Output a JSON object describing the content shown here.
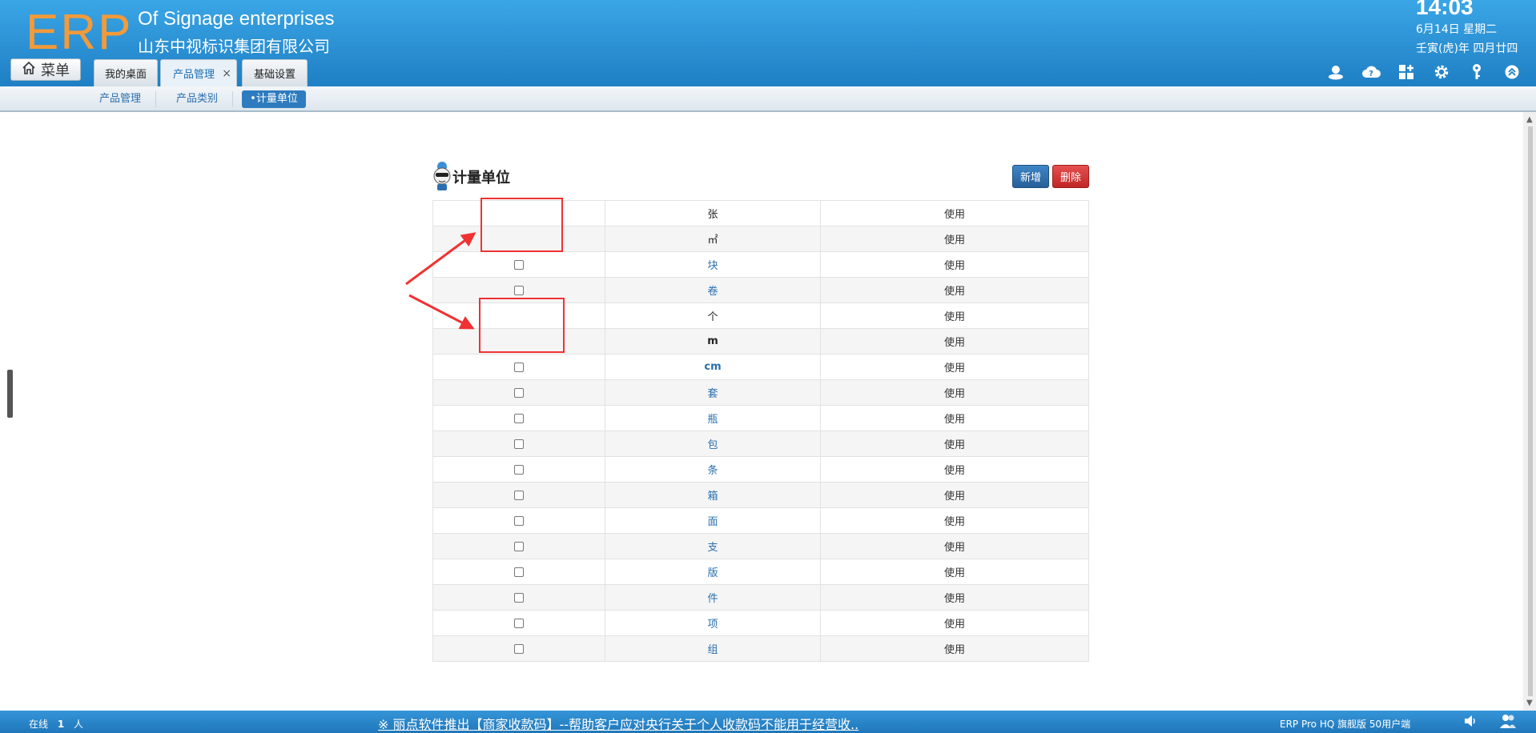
{
  "header": {
    "logo": "ERP",
    "company_en": "Of Signage enterprises",
    "company_cn": "山东中视标识集团有限公司",
    "time": "14:03",
    "date": "6月14日 星期二",
    "lunar": "壬寅(虎)年 四月廿四",
    "menu_label": "菜单",
    "tabs": [
      {
        "label": "我的桌面"
      },
      {
        "label": "产品管理",
        "close": "×"
      },
      {
        "label": "基础设置"
      }
    ],
    "tools": [
      "user-icon",
      "cloud-help-icon",
      "apps-icon",
      "gear-icon",
      "key-icon",
      "collapse-up-icon"
    ]
  },
  "subnav": {
    "items": [
      {
        "label": "产品管理"
      },
      {
        "label": "产品类别"
      },
      {
        "label": "•计量单位"
      }
    ]
  },
  "page": {
    "title": "计量单位",
    "add_label": "新增",
    "delete_label": "删除"
  },
  "units": [
    {
      "name": "张",
      "status": "使用",
      "checkbox": false,
      "link": false
    },
    {
      "name": "㎡",
      "status": "使用",
      "checkbox": false,
      "link": false
    },
    {
      "name": "块",
      "status": "使用",
      "checkbox": true,
      "link": true
    },
    {
      "name": "卷",
      "status": "使用",
      "checkbox": true,
      "link": true
    },
    {
      "name": "个",
      "status": "使用",
      "checkbox": false,
      "link": false
    },
    {
      "name": "m",
      "status": "使用",
      "checkbox": false,
      "link": false,
      "bold": true
    },
    {
      "name": "cm",
      "status": "使用",
      "checkbox": true,
      "link": true,
      "bold": true
    },
    {
      "name": "套",
      "status": "使用",
      "checkbox": true,
      "link": true
    },
    {
      "name": "瓶",
      "status": "使用",
      "checkbox": true,
      "link": true
    },
    {
      "name": "包",
      "status": "使用",
      "checkbox": true,
      "link": true
    },
    {
      "name": "条",
      "status": "使用",
      "checkbox": true,
      "link": true
    },
    {
      "name": "箱",
      "status": "使用",
      "checkbox": true,
      "link": true
    },
    {
      "name": "面",
      "status": "使用",
      "checkbox": true,
      "link": true
    },
    {
      "name": "支",
      "status": "使用",
      "checkbox": true,
      "link": true
    },
    {
      "name": "版",
      "status": "使用",
      "checkbox": true,
      "link": true
    },
    {
      "name": "件",
      "status": "使用",
      "checkbox": true,
      "link": true
    },
    {
      "name": "项",
      "status": "使用",
      "checkbox": true,
      "link": true
    },
    {
      "name": "组",
      "status": "使用",
      "checkbox": true,
      "link": true
    }
  ],
  "footer": {
    "online_label": "在线",
    "online_count": "1",
    "online_unit": "人",
    "notice": "※ 丽点软件推出【商家收款码】--帮助客户应对央行关于个人收款码不能用于经营收..",
    "version": "ERP Pro HQ 旗舰版 50用户端"
  },
  "colors": {
    "header_blue": "#2b8fd6",
    "logo_orange": "#f39a3a",
    "annotation_red": "#f03232",
    "add_button": "#2f6fad",
    "delete_button": "#d23232"
  }
}
